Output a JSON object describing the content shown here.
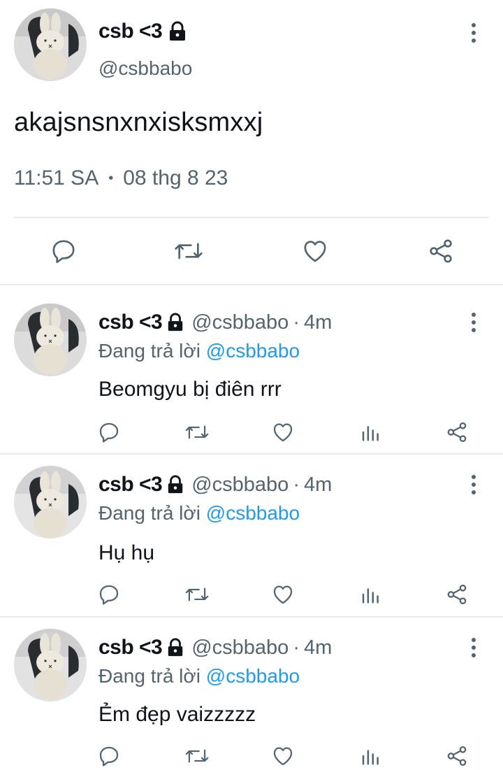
{
  "main_tweet": {
    "display_name": "csb <3",
    "handle": "@csbbabo",
    "text": "akajsnsnxnxisksmxxj",
    "time": "11:51 SA",
    "separator": "•",
    "date": "08 thg 8 23",
    "icons": [
      "lock-icon",
      "more-icon",
      "reply-icon",
      "retweet-icon",
      "like-icon",
      "share-icon"
    ]
  },
  "replies": [
    {
      "display_name": "csb <3",
      "handle": "@csbbabo",
      "separator": "·",
      "time": "4m",
      "replying_prefix": "Đang trả lời",
      "replying_to": "@csbbabo",
      "text": "Beomgyu bị điên rrr"
    },
    {
      "display_name": "csb <3",
      "handle": "@csbbabo",
      "separator": "·",
      "time": "4m",
      "replying_prefix": "Đang trả lời",
      "replying_to": "@csbbabo",
      "text": "Hụ hụ"
    },
    {
      "display_name": "csb <3",
      "handle": "@csbbabo",
      "separator": "·",
      "time": "4m",
      "replying_prefix": "Đang trả lời",
      "replying_to": "@csbbabo",
      "text": "Ẻm đẹp vaizzzzz"
    }
  ],
  "colors": {
    "text_primary": "#0f1419",
    "text_secondary": "#536471",
    "accent": "#1d9bf0",
    "divider": "#e7eaec"
  }
}
